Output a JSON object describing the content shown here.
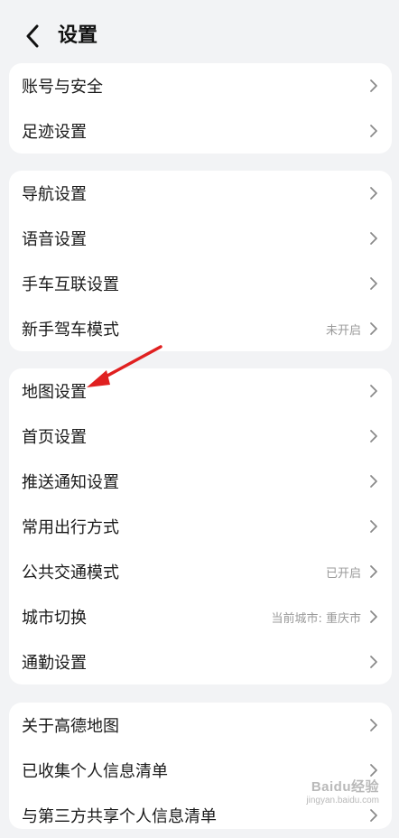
{
  "header": {
    "title": "设置"
  },
  "groups": [
    {
      "items": [
        {
          "label": "账号与安全"
        },
        {
          "label": "足迹设置"
        }
      ]
    },
    {
      "items": [
        {
          "label": "导航设置"
        },
        {
          "label": "语音设置"
        },
        {
          "label": "手车互联设置"
        },
        {
          "label": "新手驾车模式",
          "status": "未开启"
        }
      ]
    },
    {
      "items": [
        {
          "label": "地图设置"
        },
        {
          "label": "首页设置"
        },
        {
          "label": "推送通知设置"
        },
        {
          "label": "常用出行方式"
        },
        {
          "label": "公共交通模式",
          "status": "已开启"
        },
        {
          "label": "城市切换",
          "status": "当前城市: 重庆市"
        },
        {
          "label": "通勤设置"
        }
      ]
    },
    {
      "items": [
        {
          "label": "关于高德地图"
        },
        {
          "label": "已收集个人信息清单"
        },
        {
          "label": "与第三方共享个人信息清单"
        }
      ]
    }
  ],
  "watermark": {
    "logo": "Baidu经验",
    "url": "jingyan.baidu.com"
  },
  "colors": {
    "background": "#f2f3f5",
    "card": "#ffffff",
    "annotation_arrow": "#e02020"
  }
}
